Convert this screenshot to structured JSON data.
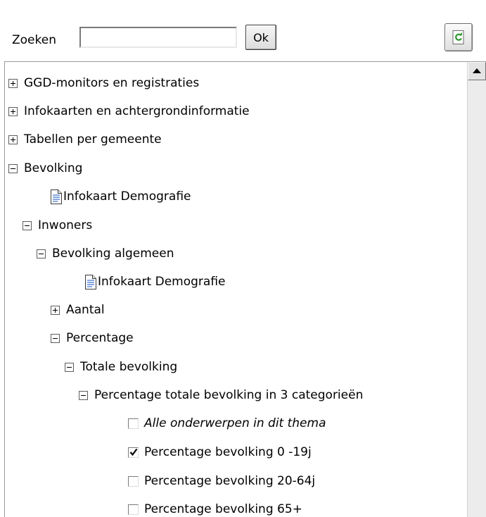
{
  "search": {
    "label": "Zoeken",
    "value": "",
    "placeholder": "",
    "ok_label": "Ok"
  },
  "tree": {
    "items": [
      {
        "label": "GGD-monitors en registraties",
        "kind": "collapsed"
      },
      {
        "label": "Infokaarten en achtergrondinformatie",
        "kind": "collapsed"
      },
      {
        "label": "Tabellen per gemeente",
        "kind": "collapsed"
      },
      {
        "label": "Bevolking",
        "kind": "expanded"
      },
      {
        "label": "Infokaart Demografie",
        "kind": "document"
      },
      {
        "label": "Inwoners",
        "kind": "expanded"
      },
      {
        "label": "Bevolking algemeen",
        "kind": "expanded"
      },
      {
        "label": "Infokaart Demografie",
        "kind": "document"
      },
      {
        "label": "Aantal",
        "kind": "collapsed"
      },
      {
        "label": "Percentage",
        "kind": "expanded"
      },
      {
        "label": "Totale bevolking",
        "kind": "expanded"
      },
      {
        "label": "Percentage totale bevolking in 3 categorieën",
        "kind": "expanded"
      },
      {
        "label": "Alle onderwerpen in dit thema",
        "kind": "checkbox",
        "checked": false
      },
      {
        "label": "Percentage bevolking 0 -19j",
        "kind": "checkbox",
        "checked": true
      },
      {
        "label": "Percentage bevolking 20-64j",
        "kind": "checkbox",
        "checked": false
      },
      {
        "label": "Percentage bevolking 65+",
        "kind": "checkbox",
        "checked": false
      }
    ]
  },
  "icons": {
    "refresh": "refresh-icon",
    "document": "document-icon",
    "scroll_up": "scroll-up-arrow-icon"
  },
  "colors": {
    "refresh_accent": "#2e9a2e",
    "document_accent": "#3a6fd0"
  }
}
